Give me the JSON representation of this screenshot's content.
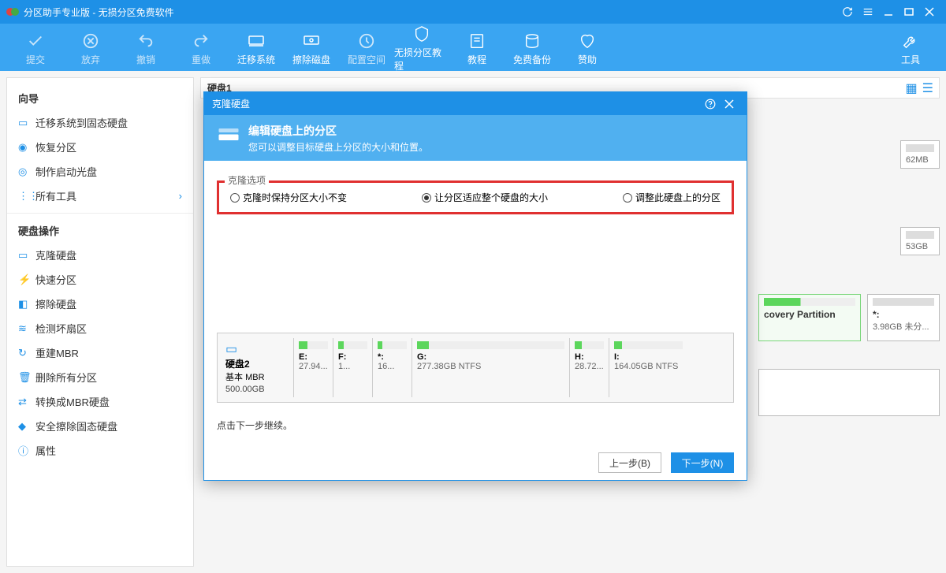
{
  "titlebar": {
    "title": "分区助手专业版 - 无损分区免费软件"
  },
  "toolbar": {
    "commit": "提交",
    "discard": "放弃",
    "undo": "撤销",
    "redo": "重做",
    "migrate": "迁移系统",
    "wipe": "擦除磁盘",
    "config": "配置空间",
    "tutorial_nondestructive": "无损分区教程",
    "tutorial": "教程",
    "backup": "免费备份",
    "sponsor": "赞助",
    "tools": "工具"
  },
  "sidebar": {
    "wizard_header": "向导",
    "wizard": [
      "迁移系统到固态硬盘",
      "恢复分区",
      "制作启动光盘",
      "所有工具"
    ],
    "disk_header": "硬盘操作",
    "diskops": [
      "克隆硬盘",
      "快速分区",
      "擦除硬盘",
      "检测坏扇区",
      "重建MBR",
      "删除所有分区",
      "转换成MBR硬盘",
      "安全擦除固态硬盘",
      "属性"
    ]
  },
  "content": {
    "disk_label": "硬盘1",
    "bg_parts": [
      {
        "size": "62MB"
      },
      {
        "size": "53GB"
      },
      {
        "name": "covery Partition"
      },
      {
        "name": "*:",
        "sub": "3.98GB 未分..."
      }
    ]
  },
  "dialog": {
    "title": "克隆硬盘",
    "header_title": "编辑硬盘上的分区",
    "header_sub": "您可以调整目标硬盘上分区的大小和位置。",
    "fieldset": "克隆选项",
    "radios": [
      "克隆时保持分区大小不变",
      "让分区适应整个硬盘的大小",
      "调整此硬盘上的分区"
    ],
    "disk": {
      "name": "硬盘2",
      "basic": "基本",
      "mbr": "MBR",
      "size": "500.00GB"
    },
    "parts": [
      {
        "drive": "E:",
        "size": "27.94...",
        "fill": 30
      },
      {
        "drive": "F:",
        "size": "1...",
        "fill": 20
      },
      {
        "drive": "*:",
        "size": "16...",
        "fill": 15
      },
      {
        "drive": "G:",
        "size": "277.38GB NTFS",
        "fill": 8,
        "wide": 200
      },
      {
        "drive": "H:",
        "size": "28.72...",
        "fill": 25
      },
      {
        "drive": "I:",
        "size": "164.05GB NTFS",
        "fill": 12,
        "wide": 100
      }
    ],
    "hint": "点击下一步继续。",
    "prev": "上一步(B)",
    "next": "下一步(N)"
  }
}
